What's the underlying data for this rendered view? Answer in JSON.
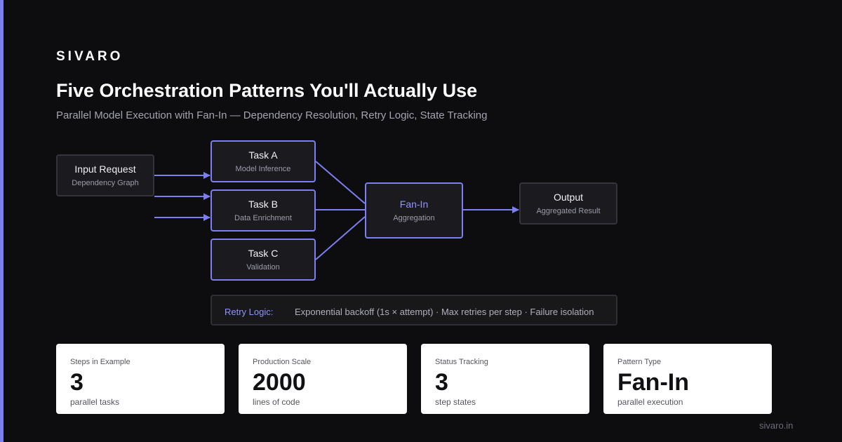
{
  "brand": "SIVARO",
  "title": "Five Orchestration Patterns You'll Actually Use",
  "subtitle": "Parallel Model Execution with Fan-In — Dependency Resolution, Retry Logic, State Tracking",
  "diagram": {
    "input": {
      "title": "Input Request",
      "sub": "Dependency Graph"
    },
    "tasks": [
      {
        "title": "Task A",
        "sub": "Model Inference"
      },
      {
        "title": "Task B",
        "sub": "Data Enrichment"
      },
      {
        "title": "Task C",
        "sub": "Validation"
      }
    ],
    "fanin": {
      "title": "Fan-In",
      "sub": "Aggregation"
    },
    "output": {
      "title": "Output",
      "sub": "Aggregated Result"
    },
    "accent_color": "#7b7ff0"
  },
  "retry": {
    "label": "Retry Logic:",
    "text": "Exponential backoff (1s × attempt) · Max retries per step · Failure isolation"
  },
  "stats": [
    {
      "label": "Steps in Example",
      "value": "3",
      "unit": "parallel tasks"
    },
    {
      "label": "Production Scale",
      "value": "2000",
      "unit": "lines of code"
    },
    {
      "label": "Status Tracking",
      "value": "3",
      "unit": "step states"
    },
    {
      "label": "Pattern Type",
      "value": "Fan-In",
      "unit": "parallel execution"
    }
  ],
  "footer": "sivaro.in"
}
